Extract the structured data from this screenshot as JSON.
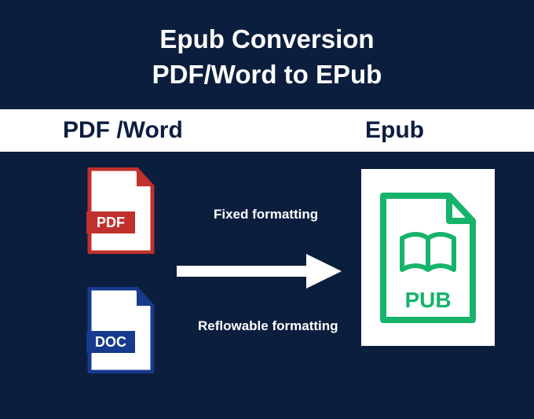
{
  "header": {
    "line1": "Epub Conversion",
    "line2": "PDF/Word to EPub"
  },
  "band": {
    "left": "PDF /Word",
    "right": "Epub"
  },
  "icons": {
    "pdf_label": "PDF",
    "doc_label": "DOC",
    "epub_label": "PUB"
  },
  "labels": {
    "fixed": "Fixed formatting",
    "reflow": "Reflowable formatting"
  },
  "colors": {
    "background": "#0c1e3e",
    "pdf_red": "#c0302c",
    "doc_blue": "#163a8d",
    "epub_green": "#16b46b",
    "white": "#ffffff"
  }
}
